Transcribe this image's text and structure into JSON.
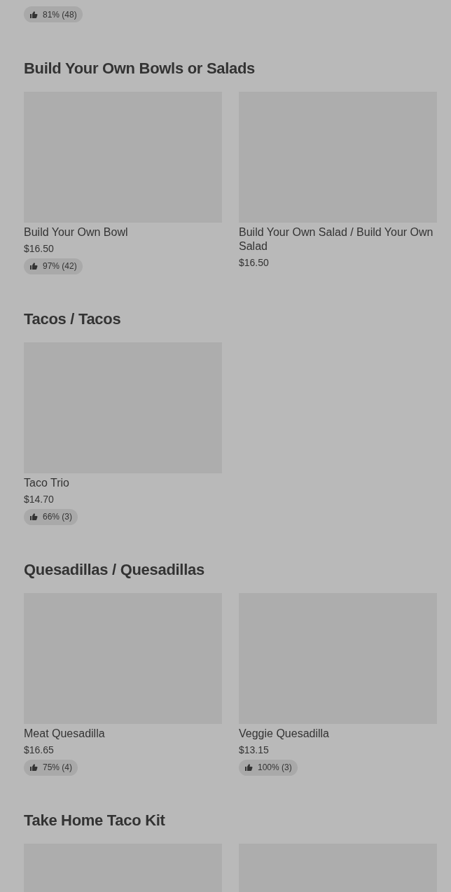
{
  "top_rating": "81% (48)",
  "sections": [
    {
      "title": "Build Your Own Bowls or Salads",
      "items": [
        {
          "kind": "full",
          "name": "Build Your Own Bowl",
          "price": "$16.50",
          "rating": "97% (42)"
        },
        {
          "kind": "full",
          "name": "Build Your Own Salad / Build Your Own Salad",
          "price": "$16.50"
        }
      ]
    },
    {
      "title": "Tacos / Tacos",
      "items": [
        {
          "kind": "full",
          "name": "Taco Trio",
          "price": "$14.70",
          "rating": "66% (3)"
        }
      ]
    },
    {
      "title": "Quesadillas / Quesadillas",
      "items": [
        {
          "kind": "full",
          "name": "Meat Quesadilla",
          "price": "$16.65",
          "rating": "75% (4)"
        },
        {
          "kind": "full",
          "name": "Veggie Quesadilla",
          "price": "$13.15",
          "rating": "100% (3)"
        }
      ]
    },
    {
      "title": "Take Home Taco Kit",
      "items": [
        {
          "kind": "image"
        },
        {
          "kind": "image"
        }
      ]
    }
  ]
}
